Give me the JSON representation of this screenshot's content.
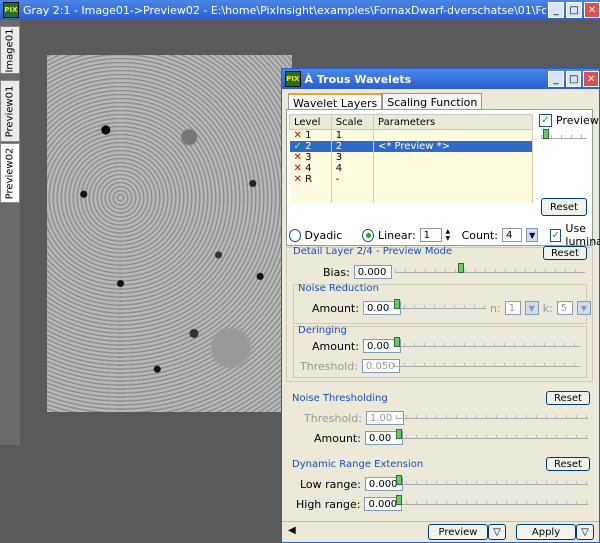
{
  "image_window": {
    "title": "Gray 2:1 - Image01->Preview02 - E:\\home\\PixInsight\\examples\\FornaxDwarf-dverschatse\\01\\FornaxDwar...",
    "app_icon": "PIX",
    "tabs": [
      "Image01",
      "Preview01",
      "Preview02"
    ],
    "active_tab": "Preview02"
  },
  "dialog": {
    "title": "À Trous Wavelets",
    "app_icon": "PIX",
    "tabs": [
      "Wavelet Layers",
      "Scaling Function"
    ],
    "layers_table": {
      "headers": [
        "Level",
        "Scale",
        "Parameters"
      ],
      "rows": [
        {
          "status": "x",
          "level": "1",
          "scale": "1",
          "params": ""
        },
        {
          "status": "check",
          "level": "2",
          "scale": "2",
          "params": "<* Preview *>"
        },
        {
          "status": "x",
          "level": "3",
          "scale": "3",
          "params": ""
        },
        {
          "status": "x",
          "level": "4",
          "scale": "4",
          "params": ""
        },
        {
          "status": "x",
          "level": "R",
          "scale": "-",
          "params": ""
        }
      ]
    },
    "preview_label": "Preview",
    "reset_label": "Reset",
    "dyadic_label": "Dyadic",
    "linear_label": "Linear:",
    "linear_value": "1",
    "count_label": "Count:",
    "count_value": "4",
    "use_luminance_label": "Use luminance",
    "detail_layer_title": "Detail Layer 2/4 - Preview Mode",
    "bias_label": "Bias:",
    "bias_value": "0.000",
    "noise_reduction_title": "Noise Reduction",
    "amount_label": "Amount:",
    "nr_amount": "0.00",
    "n_label": "n:",
    "n_value": "1",
    "k_label": "k:",
    "k_value": "5",
    "deringing_title": "Deringing",
    "dr_amount": "0.00",
    "threshold_label": "Threshold:",
    "dr_threshold": "0.050",
    "noise_thresholding_title": "Noise Thresholding",
    "nt_threshold": "1.00",
    "nt_amount": "0.00",
    "dre_title": "Dynamic Range Extension",
    "low_range_label": "Low range:",
    "low_range": "0.000",
    "high_range_label": "High range:",
    "high_range": "0.000",
    "preview_button": "Preview",
    "apply_button": "Apply"
  }
}
